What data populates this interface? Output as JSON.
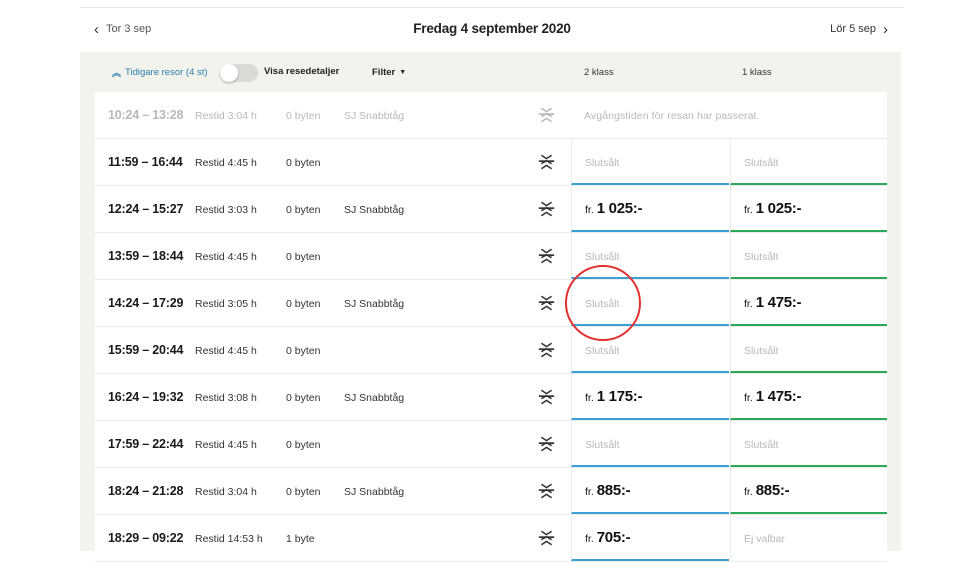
{
  "datebar": {
    "prev_label": "Tor 3 sep",
    "title": "Fredag 4 september 2020",
    "next_label": "Lör 5 sep"
  },
  "toolbar": {
    "earlier_label": "Tidigare resor (4 st)",
    "toggle_label": "Visa resedetaljer",
    "toggle_on": false,
    "filter_label": "Filter",
    "class2_label": "2 klass",
    "class1_label": "1 klass"
  },
  "colors": {
    "panel_bg": "#f2f3ec",
    "class2_accent": "#3aa0d6",
    "class1_accent": "#2ba85a",
    "link": "#2a7fb0",
    "annotation_circle": "#e23030"
  },
  "icons": [
    "chevron-left-icon",
    "chevron-right-icon",
    "double-chevron-up-icon",
    "caret-down-icon",
    "sj-logo-icon"
  ],
  "rows": [
    {
      "time": "10:24 – 13:28",
      "restid": "Restid 3:04 h",
      "byten": "0 byten",
      "tag": "SJ Snabbtåg",
      "passed": true,
      "passed_msg": "Avgångstiden för resan har passerat.",
      "c2_fr": "",
      "c2_val": "",
      "c2_sold": "",
      "c1_fr": "",
      "c1_val": "",
      "c1_sold": ""
    },
    {
      "time": "11:59 – 16:44",
      "restid": "Restid 4:45 h",
      "byten": "0 byten",
      "tag": "",
      "passed": false,
      "passed_msg": "",
      "c2_fr": "",
      "c2_val": "",
      "c2_sold": "Slutsålt",
      "c1_fr": "",
      "c1_val": "",
      "c1_sold": "Slutsålt"
    },
    {
      "time": "12:24 – 15:27",
      "restid": "Restid 3:03 h",
      "byten": "0 byten",
      "tag": "SJ Snabbtåg",
      "passed": false,
      "passed_msg": "",
      "c2_fr": "fr.",
      "c2_val": "1 025:-",
      "c2_sold": "",
      "c1_fr": "fr.",
      "c1_val": "1 025:-",
      "c1_sold": ""
    },
    {
      "time": "13:59 – 18:44",
      "restid": "Restid 4:45 h",
      "byten": "0 byten",
      "tag": "",
      "passed": false,
      "passed_msg": "",
      "c2_fr": "",
      "c2_val": "",
      "c2_sold": "Slutsålt",
      "c1_fr": "",
      "c1_val": "",
      "c1_sold": "Slutsålt"
    },
    {
      "time": "14:24 – 17:29",
      "restid": "Restid 3:05 h",
      "byten": "0 byten",
      "tag": "SJ Snabbtåg",
      "passed": false,
      "passed_msg": "",
      "c2_fr": "",
      "c2_val": "",
      "c2_sold": "Slutsålt",
      "c1_fr": "fr.",
      "c1_val": "1 475:-",
      "c1_sold": ""
    },
    {
      "time": "15:59 – 20:44",
      "restid": "Restid 4:45 h",
      "byten": "0 byten",
      "tag": "",
      "passed": false,
      "passed_msg": "",
      "c2_fr": "",
      "c2_val": "",
      "c2_sold": "Slutsålt",
      "c1_fr": "",
      "c1_val": "",
      "c1_sold": "Slutsålt"
    },
    {
      "time": "16:24 – 19:32",
      "restid": "Restid 3:08 h",
      "byten": "0 byten",
      "tag": "SJ Snabbtåg",
      "passed": false,
      "passed_msg": "",
      "c2_fr": "fr.",
      "c2_val": "1 175:-",
      "c2_sold": "",
      "c1_fr": "fr.",
      "c1_val": "1 475:-",
      "c1_sold": ""
    },
    {
      "time": "17:59 – 22:44",
      "restid": "Restid 4:45 h",
      "byten": "0 byten",
      "tag": "",
      "passed": false,
      "passed_msg": "",
      "c2_fr": "",
      "c2_val": "",
      "c2_sold": "Slutsålt",
      "c1_fr": "",
      "c1_val": "",
      "c1_sold": "Slutsålt"
    },
    {
      "time": "18:24 – 21:28",
      "restid": "Restid 3:04 h",
      "byten": "0 byten",
      "tag": "SJ Snabbtåg",
      "passed": false,
      "passed_msg": "",
      "c2_fr": "fr.",
      "c2_val": "885:-",
      "c2_sold": "",
      "c1_fr": "fr.",
      "c1_val": "885:-",
      "c1_sold": ""
    },
    {
      "time": "18:29 – 09:22",
      "restid": "Restid 14:53 h",
      "byten": "1 byte",
      "tag": "",
      "passed": false,
      "passed_msg": "",
      "c2_fr": "fr.",
      "c2_val": "705:-",
      "c2_sold": "",
      "c1_fr": "",
      "c1_val": "",
      "c1_sold": "Ej valbar"
    }
  ]
}
